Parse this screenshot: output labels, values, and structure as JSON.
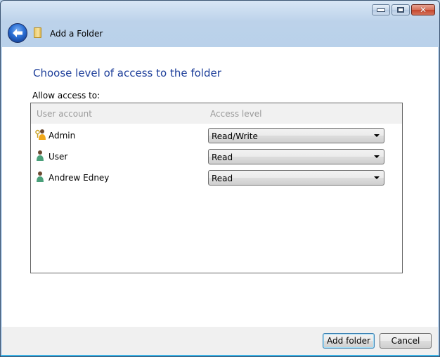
{
  "window": {
    "title": "Add a Folder",
    "caption_buttons": {
      "minimize": "minimize-icon",
      "maximize": "maximize-icon",
      "close": "close-icon"
    },
    "close_glyph": "✕",
    "back_glyph": "🡐"
  },
  "main": {
    "heading": "Choose level of access to the folder",
    "allow_label": "Allow access to:",
    "table": {
      "columns": [
        "User account",
        "Access level"
      ],
      "rows": [
        {
          "icon": "admin-user-icon",
          "name": "Admin",
          "access": "Read/Write"
        },
        {
          "icon": "user-icon",
          "name": "User",
          "access": "Read"
        },
        {
          "icon": "user-icon",
          "name": "Andrew Edney",
          "access": "Read"
        }
      ]
    }
  },
  "footer": {
    "add_label": "Add folder",
    "cancel_label": "Cancel"
  },
  "colors": {
    "heading": "#1e3f9a",
    "titlebar": "#bcd2ea",
    "footer": "#f0f0f0"
  }
}
